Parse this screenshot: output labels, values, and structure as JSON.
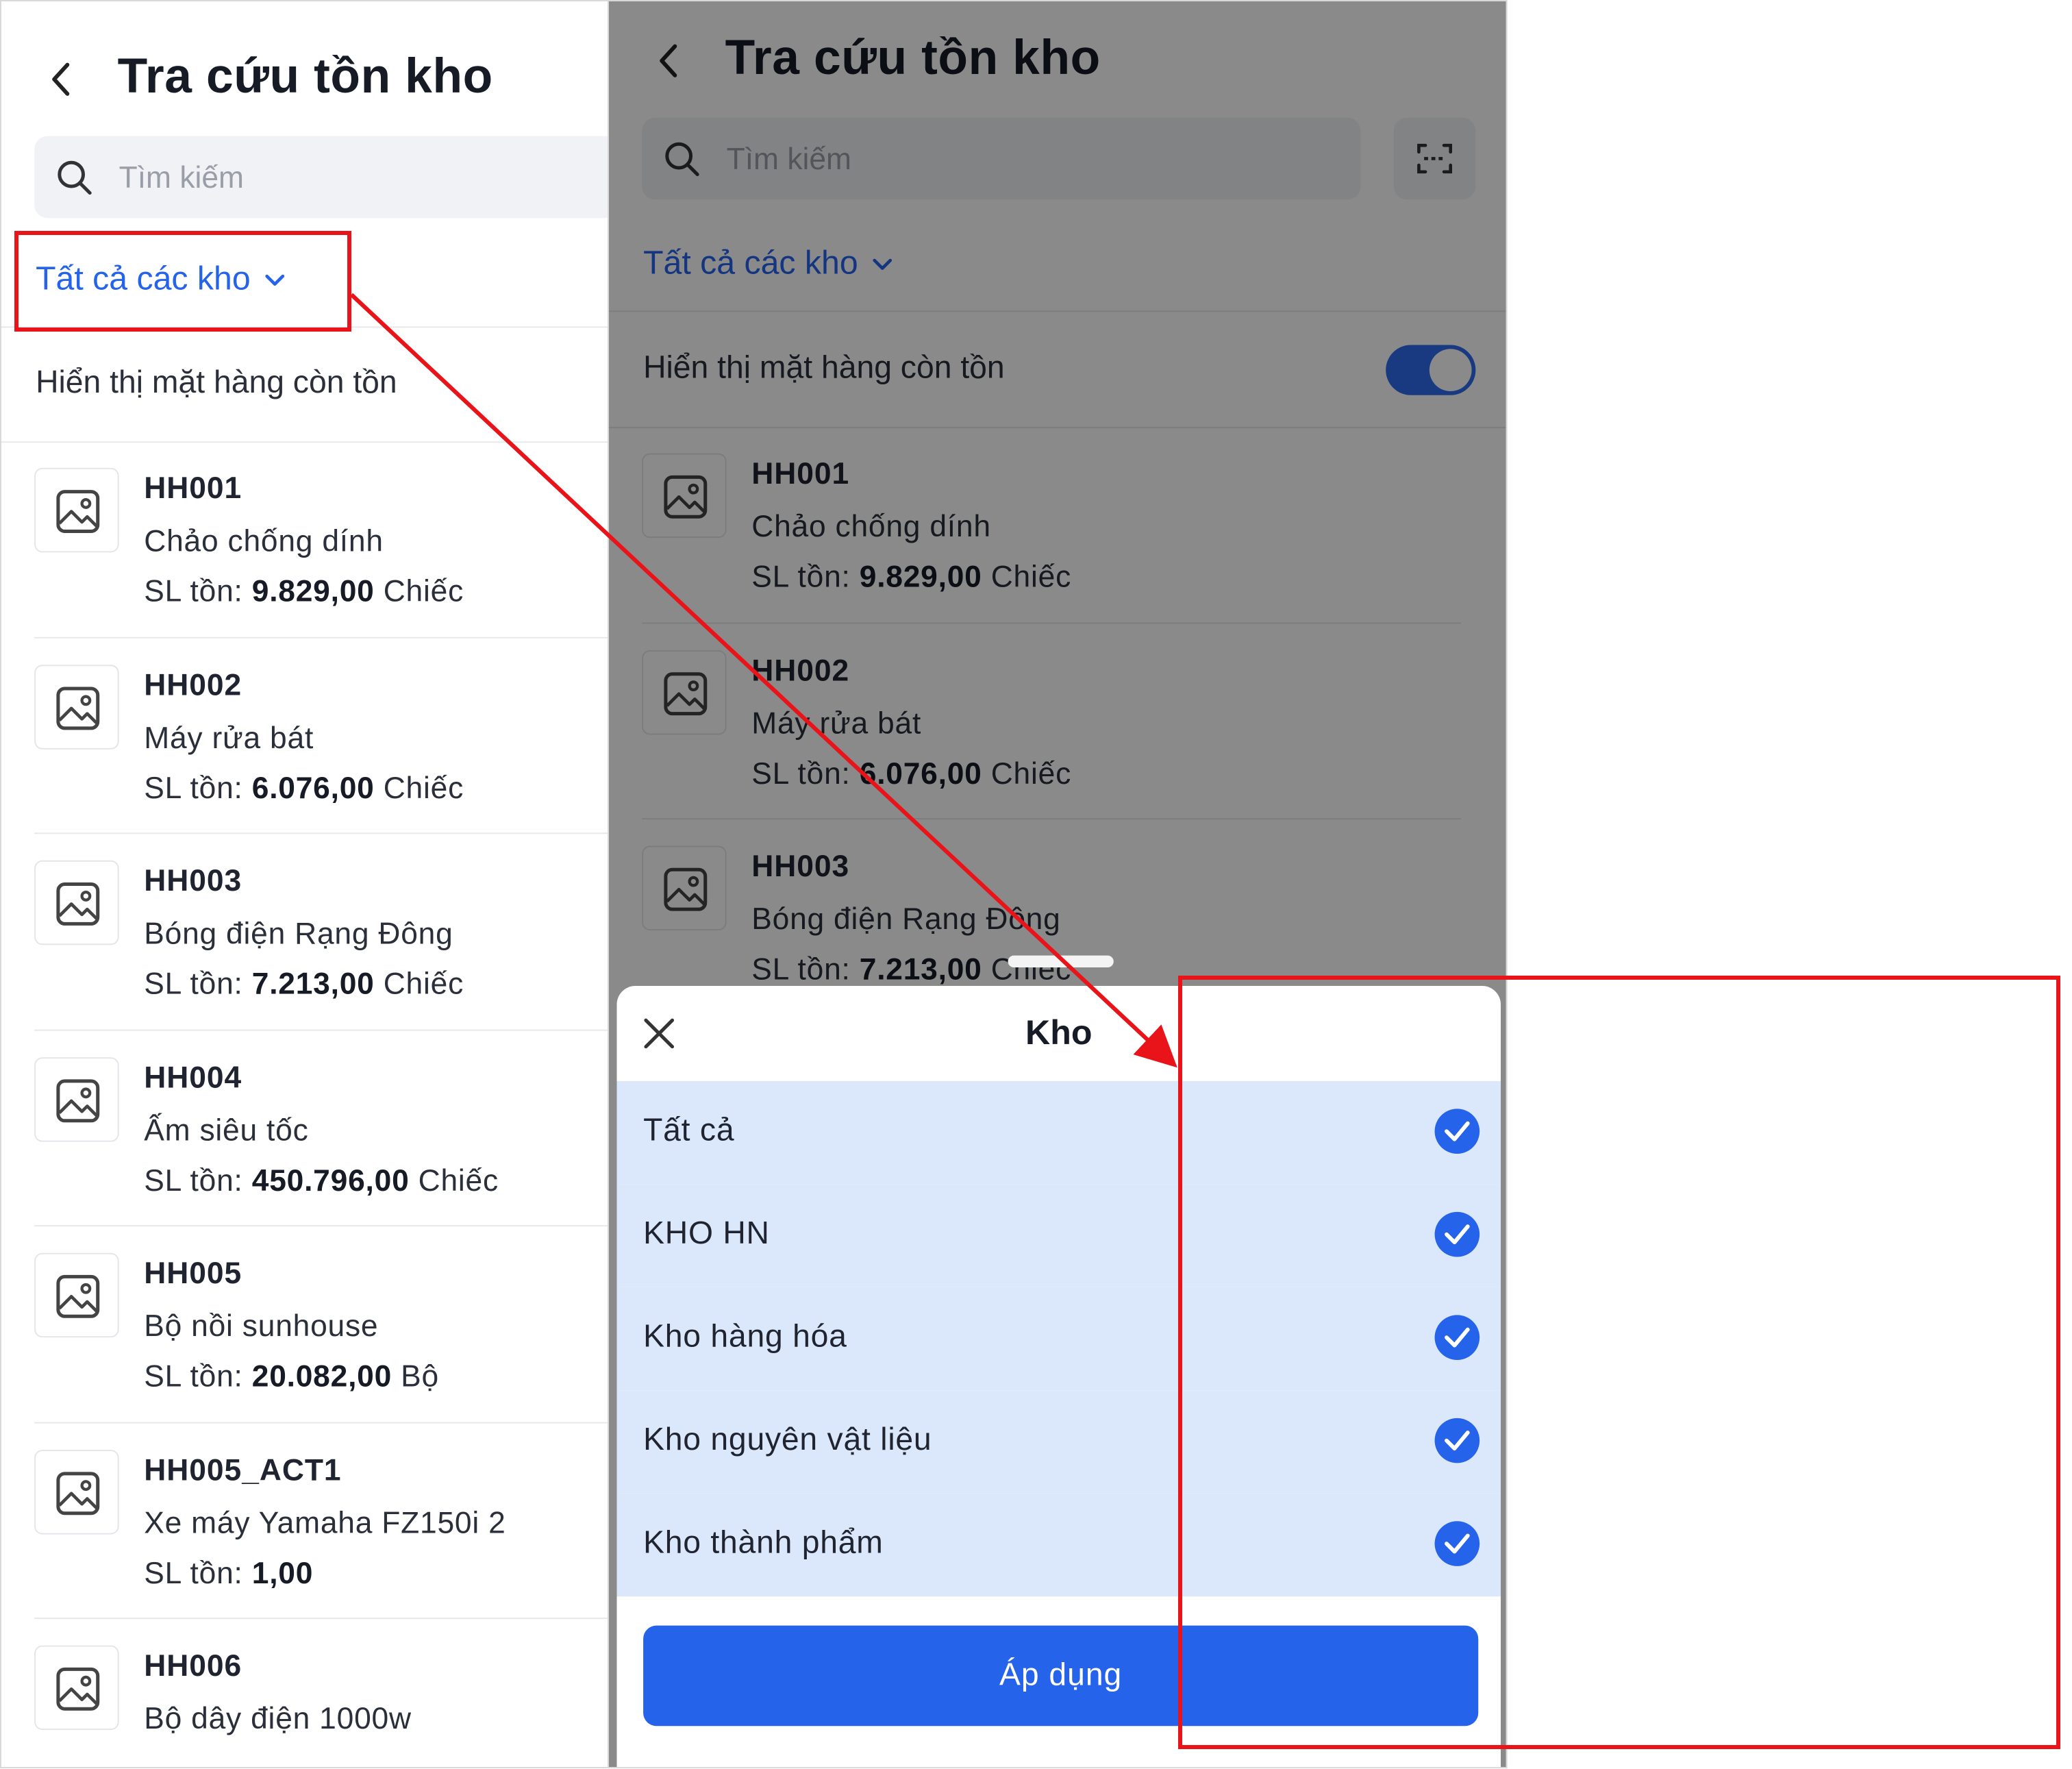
{
  "screen": {
    "title": "Tra cứu tồn kho",
    "search_placeholder": "Tìm kiếm",
    "warehouse_filter_label": "Tất cả các kho",
    "toggle_label": "Hiển thị mặt hàng còn tồn",
    "toggle_on": true,
    "qty_prefix": "SL tồn:",
    "items": [
      {
        "code": "HH001",
        "name": "Chảo chống dính",
        "qty": "9.829,00",
        "unit": "Chiếc"
      },
      {
        "code": "HH002",
        "name": "Máy rửa bát",
        "qty": "6.076,00",
        "unit": "Chiếc"
      },
      {
        "code": "HH003",
        "name": "Bóng điện Rạng Đông",
        "qty": "7.213,00",
        "unit": "Chiếc"
      },
      {
        "code": "HH004",
        "name": "Ấm siêu tốc",
        "qty": "450.796,00",
        "unit": "Chiếc"
      },
      {
        "code": "HH005",
        "name": "Bộ nồi sunhouse",
        "qty": "20.082,00",
        "unit": "Bộ"
      },
      {
        "code": "HH005_ACT1",
        "name": "Xe máy Yamaha FZ150i 2",
        "qty": "1,00",
        "unit": ""
      },
      {
        "code": "HH006",
        "name": "Bộ dây điện 1000w",
        "qty": "",
        "unit": ""
      }
    ]
  },
  "sheet": {
    "title": "Kho",
    "options": [
      {
        "label": "Tất cả",
        "checked": true
      },
      {
        "label": "KHO HN",
        "checked": true
      },
      {
        "label": "Kho hàng hóa",
        "checked": true
      },
      {
        "label": "Kho nguyên vật liệu",
        "checked": true
      },
      {
        "label": "Kho thành phẩm",
        "checked": true
      }
    ],
    "apply_label": "Áp dụng"
  },
  "colors": {
    "accent": "#2563eb",
    "annotation": "#e8141a",
    "selected_row": "#dbe7fb"
  }
}
